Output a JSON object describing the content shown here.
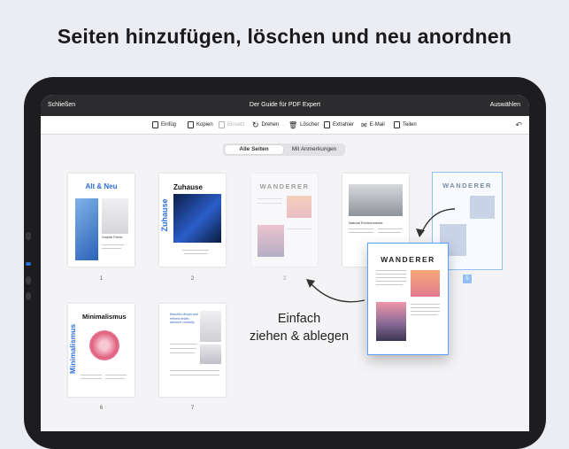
{
  "headline": "Seiten hinzufügen, löschen und neu anordnen",
  "nav": {
    "close": "Schließen",
    "title": "Der Guide für PDF Expert",
    "select": "Auswählen"
  },
  "toolbar": {
    "insert": "Einfüg",
    "copy": "Kopien",
    "paste": "Einsetz",
    "rotate": "Drehen",
    "delete": "Löscher",
    "extract": "Extrahier",
    "email": "E-Mail",
    "share": "Teilen"
  },
  "segment": {
    "all_pages": "Alle Seiten",
    "with_annotations": "Mit Anmerkungen"
  },
  "pages": {
    "p1": {
      "title": "Alt & Neu",
      "sub": "Graphic Forms",
      "num": "1"
    },
    "p2": {
      "title": "Zuhause",
      "vertical": "Zuhause",
      "num": "2"
    },
    "p3": {
      "title": "WANDERER",
      "num": "3"
    },
    "p4": {
      "sub": "Natural Environments"
    },
    "p5": {
      "title": "WANDERER"
    },
    "p6": {
      "title": "Minimalismus",
      "vertical": "Minimalismus",
      "num": "6"
    },
    "p7": {
      "quote": "Beautiful design and refined details advance creativity",
      "num": "7"
    }
  },
  "dragged": {
    "title": "WANDERER",
    "badge_num": "5"
  },
  "caption": {
    "line1": "Einfach",
    "line2": "ziehen & ablegen"
  },
  "colors": {
    "accent": "#2f6fdb",
    "nav_bg": "#2c2c2e",
    "drag_border": "#5aa0ff"
  }
}
